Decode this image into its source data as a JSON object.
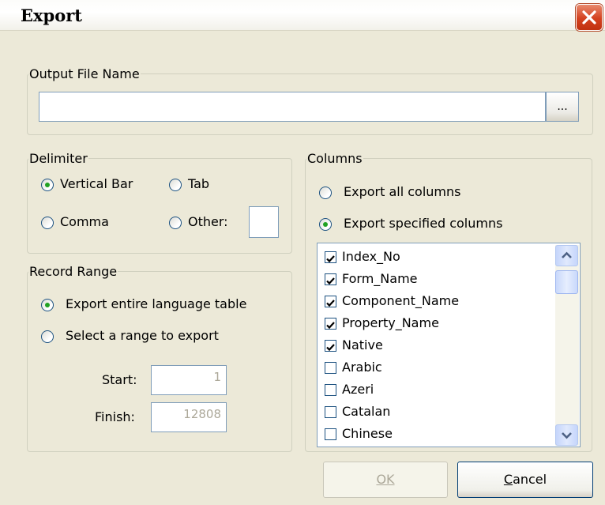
{
  "window": {
    "title": "Export"
  },
  "output_file": {
    "legend": "Output File Name",
    "value": "",
    "browse_label": "..."
  },
  "delimiter": {
    "legend": "Delimiter",
    "options": [
      {
        "label": "Vertical Bar",
        "selected": true
      },
      {
        "label": "Tab",
        "selected": false
      },
      {
        "label": "Comma",
        "selected": false
      },
      {
        "label": "Other:",
        "selected": false
      }
    ],
    "other_value": ""
  },
  "record_range": {
    "legend": "Record Range",
    "options": [
      {
        "label": "Export entire language table",
        "selected": true
      },
      {
        "label": "Select a range to export",
        "selected": false
      }
    ],
    "start_label": "Start:",
    "start_value": "1",
    "finish_label": "Finish:",
    "finish_value": "12808"
  },
  "columns": {
    "legend": "Columns",
    "options": [
      {
        "label": "Export all columns",
        "selected": false
      },
      {
        "label": "Export specified columns",
        "selected": true
      }
    ],
    "items": [
      {
        "label": "Index_No",
        "checked": true
      },
      {
        "label": "Form_Name",
        "checked": true
      },
      {
        "label": "Component_Name",
        "checked": true
      },
      {
        "label": "Property_Name",
        "checked": true
      },
      {
        "label": "Native",
        "checked": true
      },
      {
        "label": "Arabic",
        "checked": false
      },
      {
        "label": "Azeri",
        "checked": false
      },
      {
        "label": "Catalan",
        "checked": false
      },
      {
        "label": "Chinese",
        "checked": false
      }
    ]
  },
  "buttons": {
    "ok_label": "OK",
    "cancel_label": "Cancel"
  },
  "icons": {
    "close": "close-icon",
    "check": "checkmark-icon",
    "scroll_up": "chevron-up-icon",
    "scroll_down": "chevron-down-icon"
  },
  "colors": {
    "close_button": "#d4411f",
    "radio_dot": "#21a121",
    "field_border": "#7f9db9",
    "dialog_bg": "#ece9d8"
  }
}
